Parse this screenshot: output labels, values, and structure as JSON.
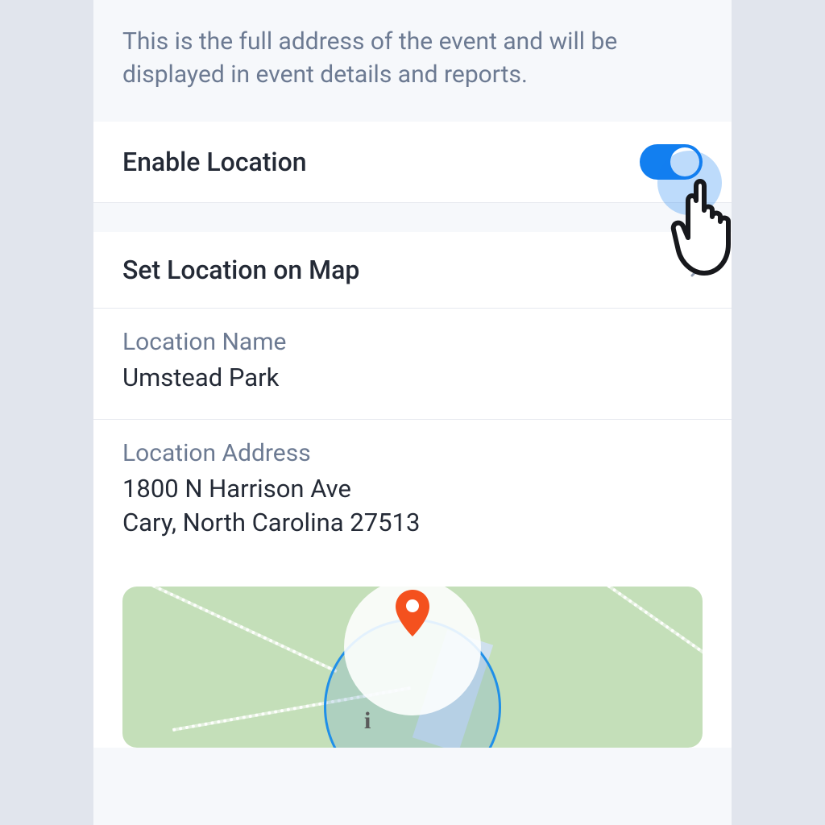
{
  "intro": "This is the full address of the event and will be displayed in event details and reports.",
  "enable_location": {
    "label": "Enable Location",
    "on": true
  },
  "set_location": {
    "label": "Set Location on Map"
  },
  "location_name": {
    "label": "Location Name",
    "value": "Umstead Park"
  },
  "location_address": {
    "label": "Location Address",
    "value": "1800 N Harrison Ave\nCary, North Carolina 27513"
  }
}
